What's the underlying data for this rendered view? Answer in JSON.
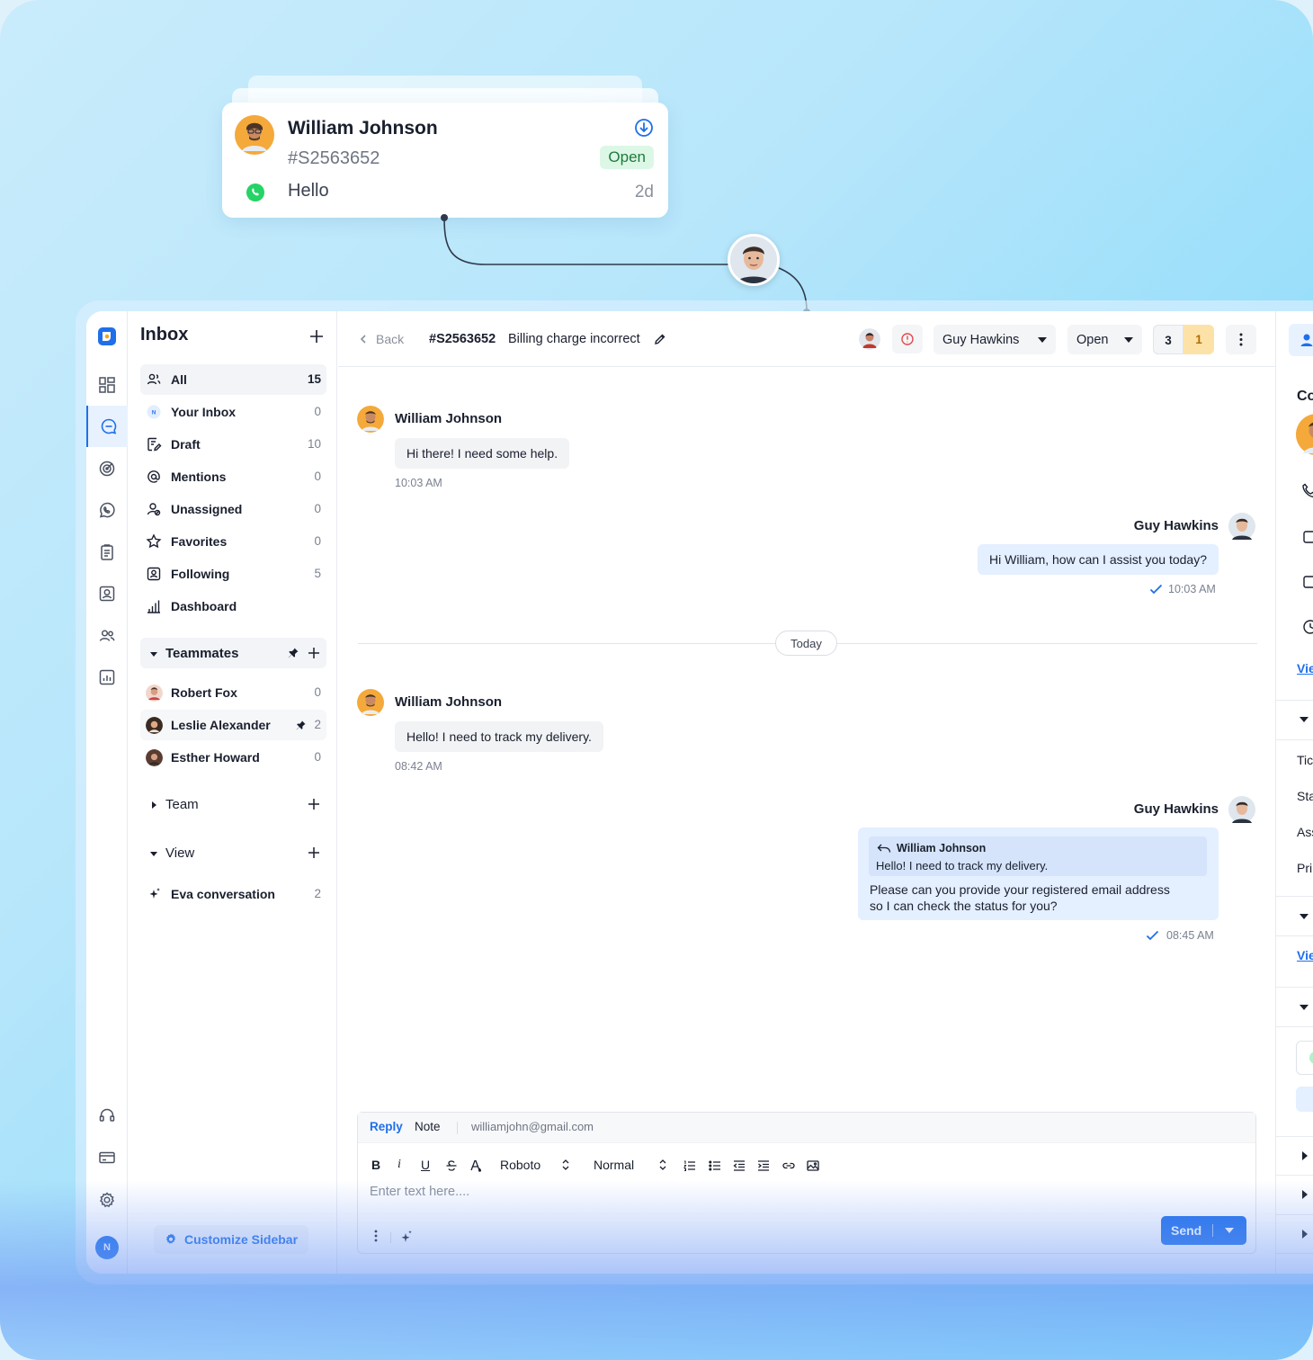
{
  "floating_card": {
    "name": "William Johnson",
    "ticket_id": "#S2563652",
    "status": "Open",
    "last_message": "Hello",
    "age": "2d",
    "channel_icon": "whatsapp-icon",
    "action_icon": "download-circle-icon"
  },
  "sidebar": {
    "title": "Inbox",
    "items": [
      {
        "label": "All",
        "count": "15",
        "icon": "users-icon"
      },
      {
        "label": "Your Inbox",
        "count": "0",
        "icon": "avatar-n-icon"
      },
      {
        "label": "Draft",
        "count": "10",
        "icon": "draft-icon"
      },
      {
        "label": "Mentions",
        "count": "0",
        "icon": "at-icon"
      },
      {
        "label": "Unassigned",
        "count": "0",
        "icon": "user-unassigned-icon"
      },
      {
        "label": "Favorites",
        "count": "0",
        "icon": "star-icon"
      },
      {
        "label": "Following",
        "count": "5",
        "icon": "following-icon"
      },
      {
        "label": "Dashboard",
        "count": "",
        "icon": "bar-chart-icon"
      }
    ],
    "teammates_label": "Teammates",
    "teammates": [
      {
        "name": "Robert Fox",
        "count": "0"
      },
      {
        "name": "Leslie Alexander",
        "count": "2"
      },
      {
        "name": "Esther Howard",
        "count": "0"
      }
    ],
    "team_label": "Team",
    "view_label": "View",
    "eva_label": "Eva conversation",
    "eva_count": "2",
    "customize_label": "Customize Sidebar",
    "user_initial": "N"
  },
  "topbar": {
    "back_label": "Back",
    "ticket_id": "#S2563652",
    "subject": "Billing charge incorrect",
    "assignee": "Guy Hawkins",
    "status": "Open",
    "count_a": "3",
    "count_b": "1"
  },
  "messages": [
    {
      "author": "William Johnson",
      "text": "Hi there! I need some help.",
      "time": "10:03 AM"
    },
    {
      "author": "Guy Hawkins",
      "text": "Hi William, how can I assist you today?",
      "time": "10:03 AM"
    },
    {
      "author": "William Johnson",
      "text": "Hello! I need to track my delivery.",
      "time": "08:42 AM"
    },
    {
      "author": "Guy Hawkins",
      "quote_author": "William Johnson",
      "quote_text": "Hello! I need to track my delivery.",
      "text_line1": "Please can you provide your registered email address",
      "text_line2": "so I can check the status for you?",
      "time": "08:45 AM"
    }
  ],
  "divider_label": "Today",
  "composer": {
    "tab_reply": "Reply",
    "tab_note": "Note",
    "to_email": "williamjohn@gmail.com",
    "font": "Roboto",
    "size": "Normal",
    "placeholder": "Enter text here....",
    "send_label": "Send",
    "bold": "B",
    "italic": "i",
    "underline": "U"
  },
  "right_panel": {
    "heading": "Co",
    "link1": "Vie",
    "row_tic": "Tic",
    "row_sta": "Sta",
    "row_ass": "Ass",
    "row_pri": "Pri",
    "link2": "Vie"
  },
  "colors": {
    "accent": "#1f6feb",
    "open_badge_bg": "#dcf7e6",
    "unread_badge": "#fde2a8"
  }
}
